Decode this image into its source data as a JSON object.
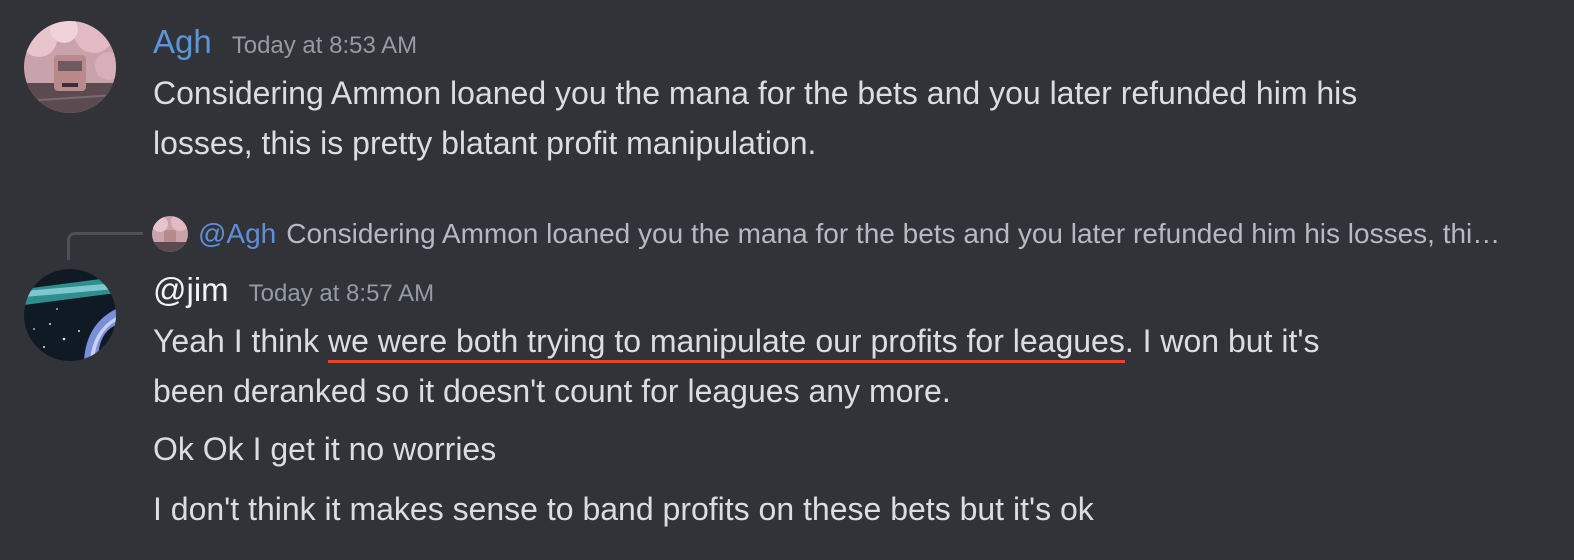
{
  "messages": [
    {
      "username": "Agh",
      "username_color": "#5d96d8",
      "timestamp": "Today at 8:53 AM",
      "lines": [
        "Considering Ammon loaned you the mana for the bets and you later refunded him his",
        "losses, this is pretty blatant profit manipulation."
      ]
    },
    {
      "reply": {
        "mention": "@Agh",
        "preview": "Considering Ammon loaned you the mana for the bets and you later refunded him his losses, this is pretty blatant profit manipulation."
      },
      "username": "@jim",
      "username_color": "#f2f3f5",
      "timestamp": "Today at 8:57 AM",
      "line1_before": "Yeah I think ",
      "line1_underlined": "we were both trying to manipulate our profits for leagues",
      "line1_after": ". I won but it's",
      "line2": "been deranked so it doesn't count for leagues any more."
    }
  ],
  "followups": [
    "Ok Ok I get it no worries",
    "I don't think it makes sense to band profits on these bets but it's ok"
  ],
  "colors": {
    "background": "#313338",
    "annotation_underline": "#e8432e"
  },
  "icons": {
    "agh_avatar": "cherry-blossom-train-avatar",
    "jim_avatar": "night-sky-avatar"
  }
}
